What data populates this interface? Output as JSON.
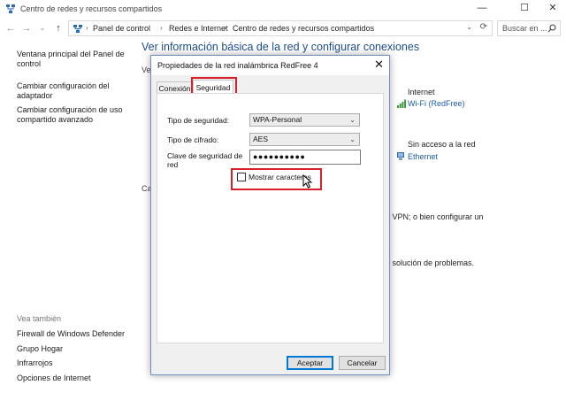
{
  "window": {
    "title": "Centro de redes y recursos compartidos",
    "minimize_glyph": "—",
    "maximize_glyph": "☐",
    "close_glyph": "✕"
  },
  "nav": {
    "back_glyph": "←",
    "forward_glyph": "→",
    "recent_glyph": "⌄",
    "up_glyph": "↑",
    "breadcrumb": [
      "Panel de control",
      "Redes e Internet",
      "Centro de redes y recursos compartidos"
    ],
    "separator": "›",
    "dropdown_glyph": "⌄",
    "refresh_glyph": "⟳",
    "search_placeholder": "Buscar en ..."
  },
  "left_pane": {
    "links": [
      {
        "line1": "Ventana principal del Panel de",
        "line2": "control"
      },
      {
        "line1": "Cambiar configuración del",
        "line2": "adaptador"
      },
      {
        "line1": "Cambiar configuración de uso",
        "line2": "compartido avanzado"
      }
    ],
    "see_also_title": "Vea también",
    "see_also": [
      "Firewall de Windows Defender",
      "Grupo Hogar",
      "Infrarrojos",
      "Opciones de Internet"
    ]
  },
  "main": {
    "title": "Ver información básica de la red y configurar conexiones",
    "partial_ver": "Ver",
    "partial_ca": "Ca",
    "internet_label": "Internet",
    "wifi_link": "Wi-Fi (RedFree)",
    "no_access_label": "Sin acceso a la red",
    "ethernet_link": "Ethernet",
    "vpn_text": "o VPN; o bien configurar un",
    "troubleshoot_text": "e solución de problemas."
  },
  "dialog": {
    "title": "Propiedades de la red inalámbrica RedFree 4",
    "close_glyph": "✕",
    "tabs": [
      "Conexión",
      "Seguridad"
    ],
    "security_type_label": "Tipo de seguridad:",
    "security_type_value": "WPA-Personal",
    "cipher_label": "Tipo de cifrado:",
    "cipher_value": "AES",
    "key_label_line1": "Clave de seguridad de",
    "key_label_line2": "red",
    "key_value": "●●●●●●●●●●",
    "show_chars_label": "Mostrar caracteres",
    "ok_label": "Aceptar",
    "cancel_label": "Cancelar",
    "dropdown_glyph": "⌄"
  },
  "colors": {
    "link": "#1e5ba8",
    "title_blue": "#1e4e8c",
    "highlight_red": "#d6202a",
    "default_button_border": "#0078d7"
  },
  "icons": [
    "network-center-icon",
    "search-icon",
    "wifi-signal-icon",
    "ethernet-icon",
    "mouse-cursor-icon"
  ]
}
